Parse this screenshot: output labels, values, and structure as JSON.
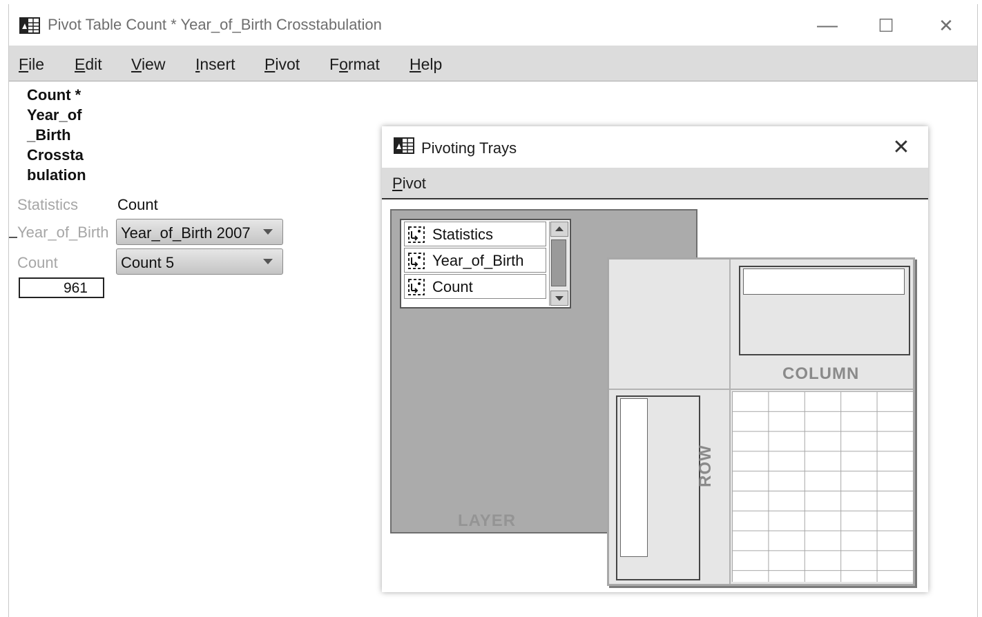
{
  "window": {
    "title": "Pivot Table Count * Year_of_Birth Crosstabulation",
    "icon": "spss-table-icon",
    "controls": {
      "minimize": "—",
      "maximize": "☐",
      "close": "✕"
    }
  },
  "menubar": {
    "items": [
      {
        "label": "File",
        "mnemonic": "F",
        "rest": "ile"
      },
      {
        "label": "Edit",
        "mnemonic": "E",
        "rest": "dit"
      },
      {
        "label": "View",
        "mnemonic": "V",
        "rest": "iew"
      },
      {
        "label": "Insert",
        "mnemonic": "I",
        "rest": "nsert"
      },
      {
        "label": "Pivot",
        "mnemonic": "P",
        "rest": "ivot"
      },
      {
        "label": "Format",
        "pre": "F",
        "mnemonic": "o",
        "rest": "rmat"
      },
      {
        "label": "Help",
        "mnemonic": "H",
        "rest": "elp"
      }
    ]
  },
  "pivot_table": {
    "title_lines": [
      "Count *",
      "Year_of",
      "_Birth",
      "Crossta",
      "bulation"
    ],
    "layers": [
      {
        "label": "Statistics",
        "value": "Count"
      },
      {
        "label": "Year_of_Birth",
        "dropdown": "Year_of_Birth 2007"
      },
      {
        "label": "Count",
        "dropdown": "Count 5"
      }
    ],
    "cell_value": "961"
  },
  "dialog": {
    "title": "Pivoting Trays",
    "close": "✕",
    "menu": {
      "mnemonic": "P",
      "rest": "ivot"
    },
    "layer_items": [
      "Statistics",
      "Year_of_Birth",
      "Count"
    ],
    "labels": {
      "layer": "LAYER",
      "column": "COLUMN",
      "row": "ROW"
    }
  }
}
